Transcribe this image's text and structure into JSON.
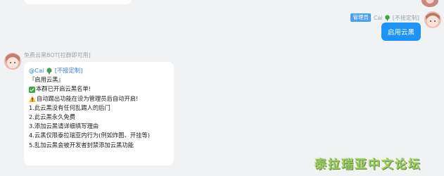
{
  "my_message": {
    "role_badge": "管理员",
    "sender_name": "Cai",
    "sender_suffix": "[不接定制]",
    "text": "启用云黑"
  },
  "bot_message": {
    "sender_name": "免费云黑BOT[拉群即可用]",
    "mention_name": "@Cai",
    "mention_suffix": "[不接定制]",
    "lines": [
      "『启用云黑』",
      "本群已开启云黑名单!",
      "自动踢出功能在设为管理员后自动开启!",
      "1.此云黑没有任何乱踢人的后门",
      "2.此云黑永久免费",
      "3.添加云黑请详细填写理由",
      "4.云黑仅限泰拉瑞亚内行为(例如炸图、开挂等)",
      "5.乱加云黑会被开发者封禁添加云黑功能"
    ]
  },
  "watermark": "泰拉瑞亚中文论坛",
  "colors": {
    "background": "#f1f2f4",
    "my_bubble": "#1e93f7",
    "mention": "#3b7fd9",
    "badge": "#4a9ff5"
  }
}
